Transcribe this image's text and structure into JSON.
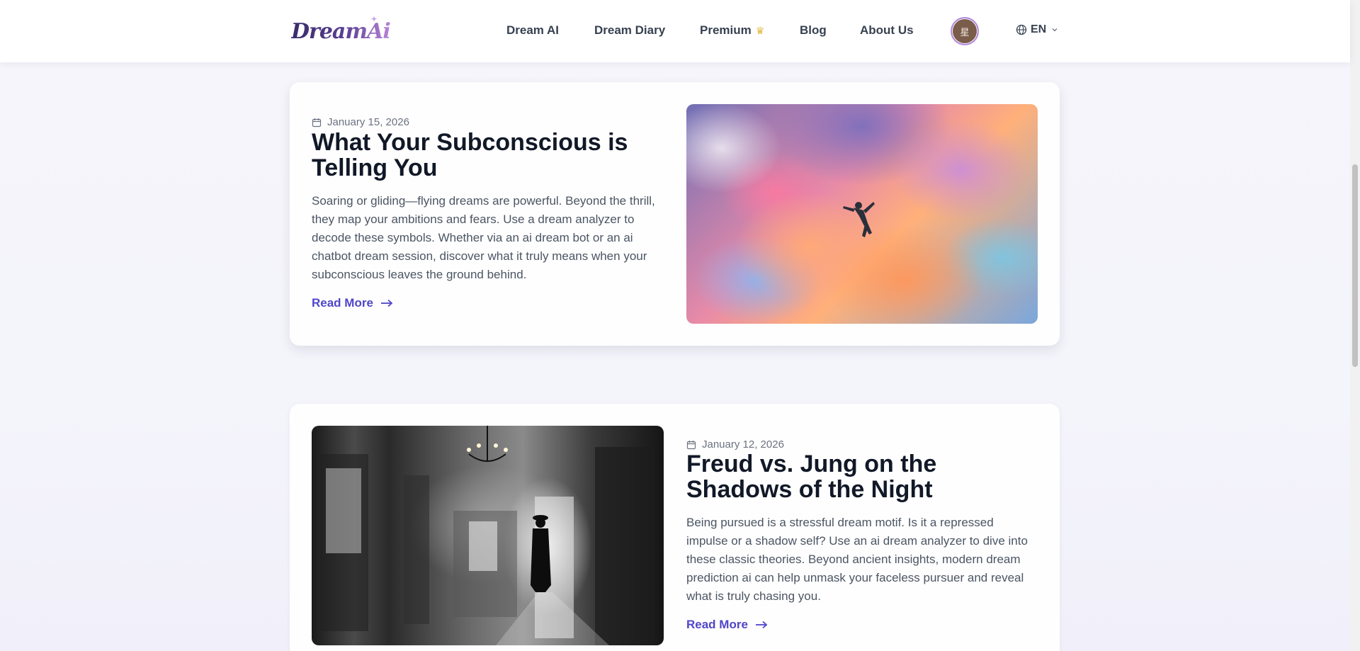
{
  "header": {
    "logo_text": "DreamAi",
    "nav": [
      {
        "label": "Dream AI"
      },
      {
        "label": "Dream Diary"
      },
      {
        "label": "Premium"
      },
      {
        "label": "Blog"
      },
      {
        "label": "About Us"
      }
    ],
    "avatar_text": "星",
    "language": "EN"
  },
  "posts": [
    {
      "date": "January 15, 2026",
      "title": "What Your Subconscious is Telling You",
      "excerpt": "Soaring or gliding—flying dreams are powerful. Beyond the thrill, they map your ambitions and fears. Use a dream analyzer to decode these symbols. Whether via an ai dream bot or an ai chatbot dream session, discover what it truly means when your subconscious leaves the ground behind.",
      "read_more": "Read More",
      "image_icon": "flying-person-clouds-image"
    },
    {
      "date": "January 12, 2026",
      "title": "Freud vs. Jung on the Shadows of the Night",
      "excerpt": "Being pursued is a stressful dream motif. Is it a repressed impulse or a shadow self? Use an ai dream analyzer to dive into these classic theories. Beyond ancient insights, modern dream prediction ai can help unmask your faceless pursuer and reveal what is truly chasing you.",
      "read_more": "Read More",
      "image_icon": "dark-hallway-shadow-figure-image"
    }
  ],
  "colors": {
    "accent": "#4f46c8",
    "premium_crown": "#e2b93b",
    "avatar_border": "#b48ae0"
  }
}
